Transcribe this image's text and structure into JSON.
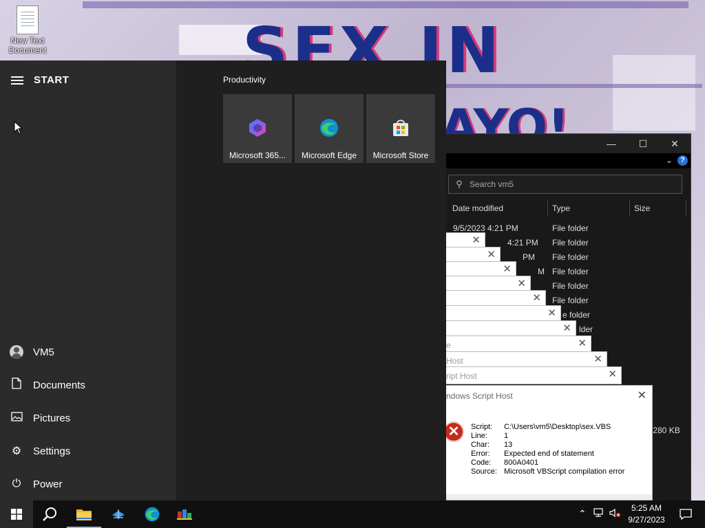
{
  "desktop": {
    "icons": [
      {
        "label": "New Text Document"
      }
    ],
    "wallpaper_text": "SEX IN",
    "wallpaper_text2": "AYO!"
  },
  "start_menu": {
    "title": "START",
    "user": "VM5",
    "items": [
      "Documents",
      "Pictures",
      "Settings",
      "Power"
    ],
    "group_label": "Productivity",
    "tiles": [
      {
        "label": "Microsoft 365...",
        "icon": "microsoft-365-icon"
      },
      {
        "label": "Microsoft Edge",
        "icon": "edge-icon"
      },
      {
        "label": "Microsoft Store",
        "icon": "store-icon"
      }
    ]
  },
  "explorer": {
    "search_placeholder": "Search vm5",
    "columns": [
      "Date modified",
      "Type",
      "Size"
    ],
    "rows": [
      {
        "date": "9/5/2023 4:21 PM",
        "type": "File folder"
      },
      {
        "date": "4:21 PM",
        "type": "File folder"
      },
      {
        "date": "PM",
        "type": "File folder"
      },
      {
        "date": "M",
        "type": "File folder"
      },
      {
        "date": "",
        "type": "File folder"
      },
      {
        "date": "",
        "type": "File folder"
      },
      {
        "date": "",
        "type": "e folder"
      },
      {
        "date": "",
        "type": "lder"
      }
    ],
    "size_fragment": ",280 KB"
  },
  "error_stack": {
    "partial_titles": [
      "",
      "",
      "",
      "",
      "",
      "",
      "",
      "",
      "e",
      "Host",
      "ript Host"
    ]
  },
  "dialog": {
    "title": "ndows Script Host",
    "fields": [
      {
        "key": "Script:",
        "value": "C:\\Users\\vm5\\Desktop\\sex.VBS"
      },
      {
        "key": "Line:",
        "value": "1"
      },
      {
        "key": "Char:",
        "value": "13"
      },
      {
        "key": "Error:",
        "value": "Expected end of statement"
      },
      {
        "key": "Code:",
        "value": "800A0401"
      },
      {
        "key": "Source:",
        "value": "Microsoft VBScript compilation error"
      }
    ]
  },
  "taskbar": {
    "time": "5:25 AM",
    "date": "9/27/2023"
  },
  "colors": {
    "accent": "#2c6fd6",
    "error_red": "#c42b1c",
    "start_bg": "#1f1f1f",
    "start_left_bg": "#2b2b2b",
    "taskbar_bg": "#101010"
  }
}
